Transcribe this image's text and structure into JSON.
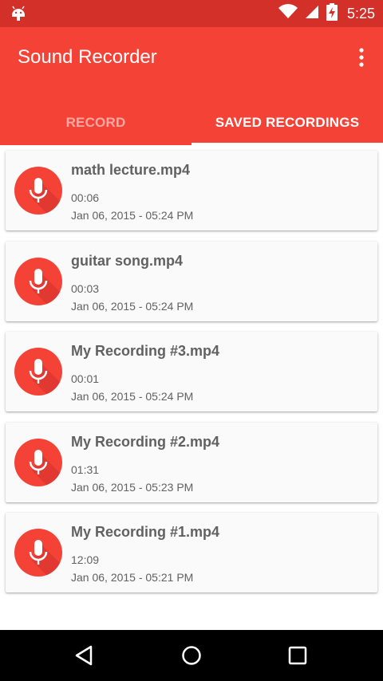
{
  "status_bar": {
    "time": "5:25",
    "icons": [
      "android-icon",
      "wifi-icon",
      "signal-icon",
      "battery-charging-icon"
    ]
  },
  "app_bar": {
    "title": "Sound Recorder",
    "menu_icon": "overflow-menu-icon",
    "color": "#f44336"
  },
  "tabs": [
    {
      "label": "RECORD",
      "active": false
    },
    {
      "label": "SAVED RECORDINGS",
      "active": true
    }
  ],
  "recordings": [
    {
      "name": "math lecture.mp4",
      "length": "00:06",
      "date": "Jan 06, 2015 - 05:24 PM",
      "icon": "microphone-icon"
    },
    {
      "name": "guitar song.mp4",
      "length": "00:03",
      "date": "Jan 06, 2015 - 05:24 PM",
      "icon": "microphone-icon"
    },
    {
      "name": "My Recording #3.mp4",
      "length": "00:01",
      "date": "Jan 06, 2015 - 05:24 PM",
      "icon": "microphone-icon"
    },
    {
      "name": "My Recording #2.mp4",
      "length": "01:31",
      "date": "Jan 06, 2015 - 05:23 PM",
      "icon": "microphone-icon"
    },
    {
      "name": "My Recording #1.mp4",
      "length": "12:09",
      "date": "Jan 06, 2015 - 05:21 PM",
      "icon": "microphone-icon"
    }
  ],
  "nav_bar": {
    "icons": [
      "back-icon",
      "home-icon",
      "recents-icon"
    ]
  }
}
